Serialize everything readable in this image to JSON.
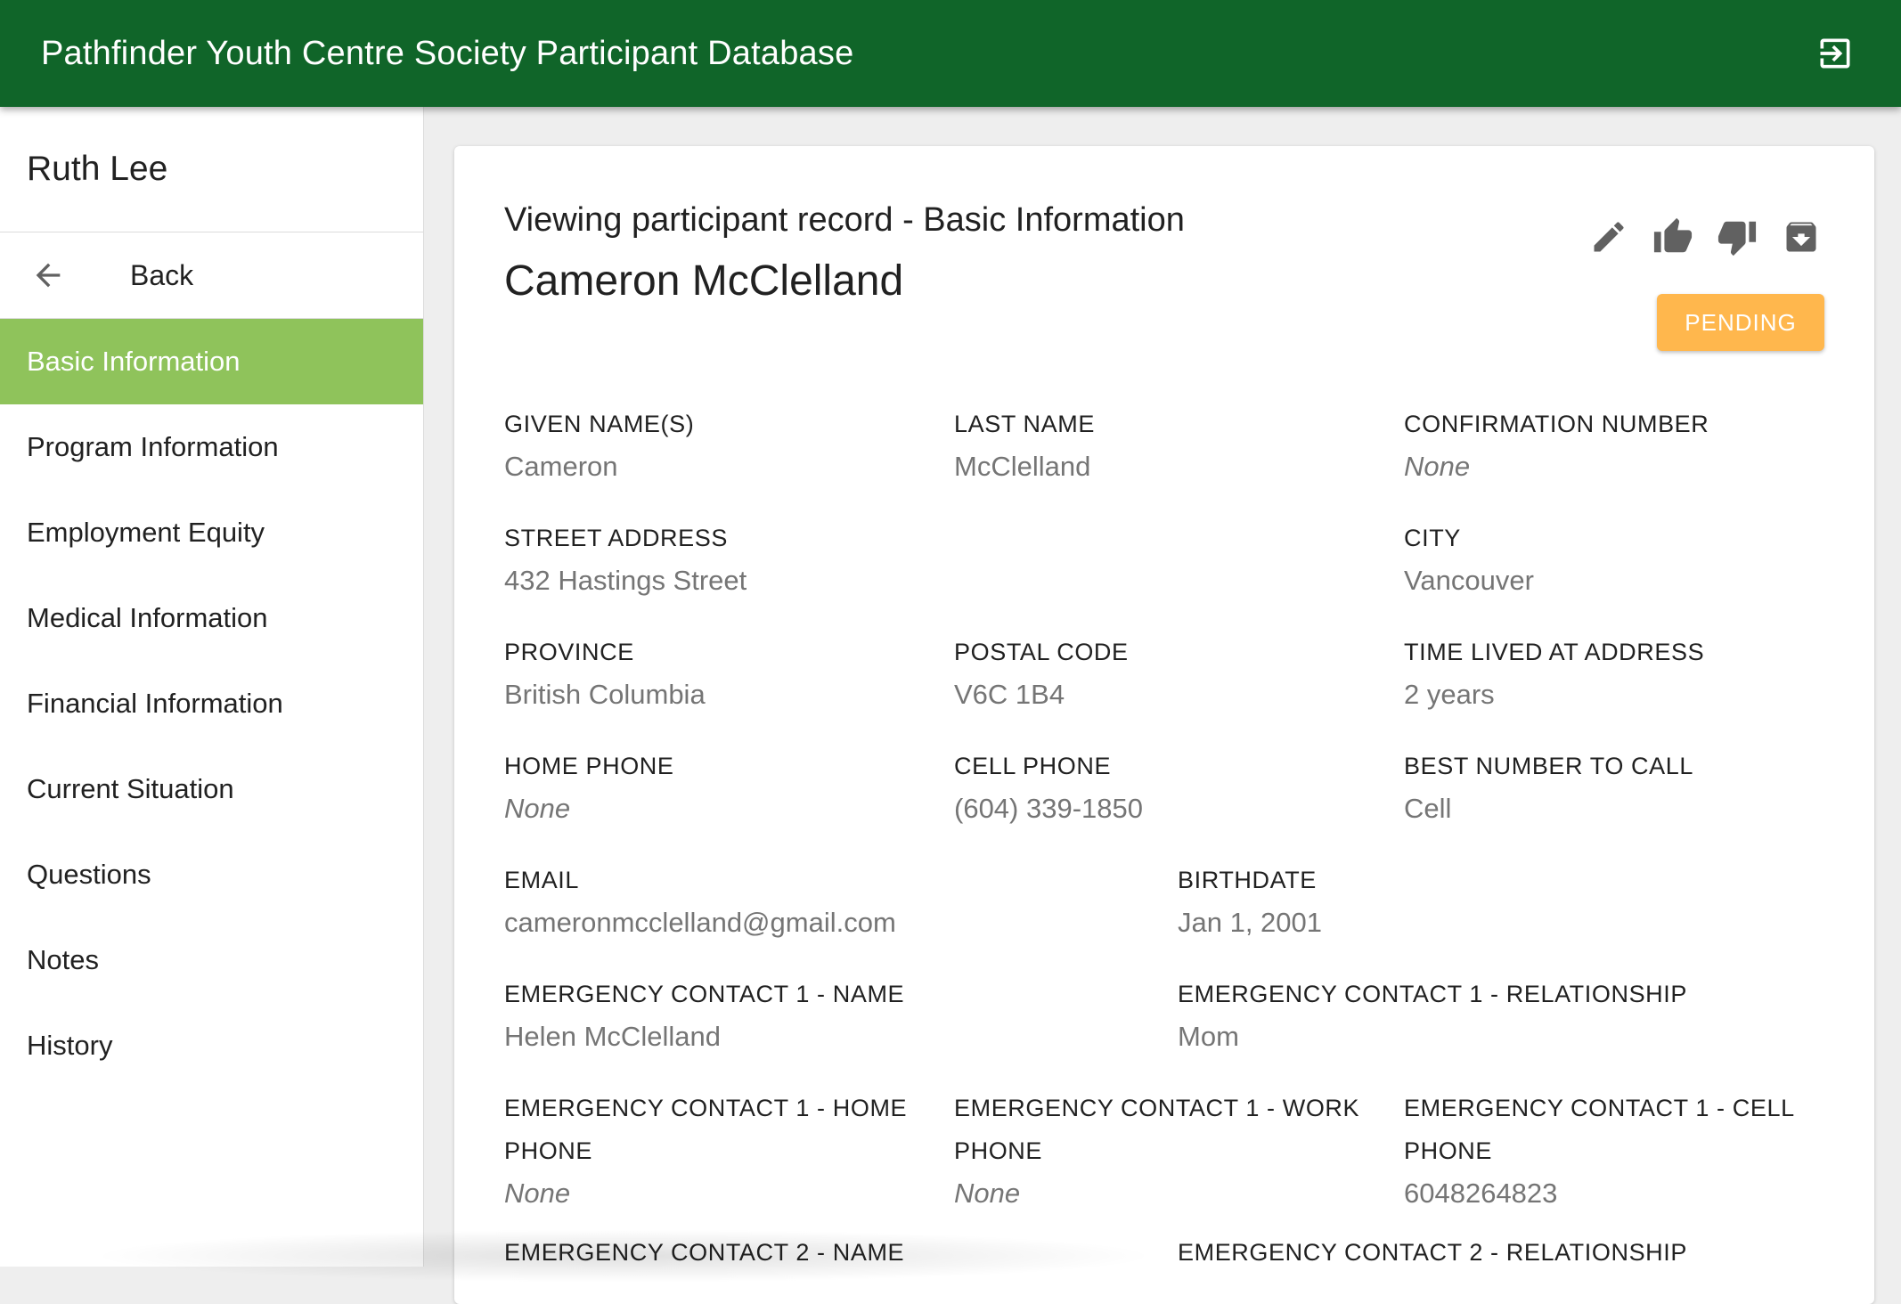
{
  "app": {
    "title": "Pathfinder Youth Centre Society Participant Database"
  },
  "drawer": {
    "user_name": "Ruth Lee",
    "back_label": "Back",
    "items": [
      {
        "label": "Basic Information",
        "active": true
      },
      {
        "label": "Program Information"
      },
      {
        "label": "Employment Equity"
      },
      {
        "label": "Medical Information"
      },
      {
        "label": "Financial Information"
      },
      {
        "label": "Current Situation"
      },
      {
        "label": "Questions"
      },
      {
        "label": "Notes"
      },
      {
        "label": "History"
      }
    ]
  },
  "record": {
    "title": "Viewing participant record - Basic Information",
    "participant_name": "Cameron McClelland",
    "status": "PENDING",
    "fields": [
      {
        "label": "Given Name(s)",
        "value": "Cameron"
      },
      {
        "label": "Last Name",
        "value": "McClelland"
      },
      {
        "label": "Confirmation Number",
        "value": "None"
      },
      {
        "label": "Street Address",
        "value": "432 Hastings Street"
      },
      {
        "label": "City",
        "value": "Vancouver"
      },
      {
        "label": "Province",
        "value": "British Columbia"
      },
      {
        "label": "Postal Code",
        "value": "V6C 1B4"
      },
      {
        "label": "Time Lived at Address",
        "value": "2 years"
      },
      {
        "label": "Home Phone",
        "value": "None"
      },
      {
        "label": "Cell Phone",
        "value": "(604) 339-1850"
      },
      {
        "label": "Best Number to Call",
        "value": "Cell"
      },
      {
        "label": "Email",
        "value": "cameronmcclelland@gmail.com"
      },
      {
        "label": "Birthdate",
        "value": "Jan 1, 2001"
      },
      {
        "label": "Emergency Contact 1 - Name",
        "value": "Helen McClelland"
      },
      {
        "label": "Emergency Contact 1 - Relationship",
        "value": "Mom"
      },
      {
        "label": "Emergency Contact 1 - Home Phone",
        "value": "None"
      },
      {
        "label": "Emergency Contact 1 - Work Phone",
        "value": "None"
      },
      {
        "label": "Emergency Contact 1 - Cell Phone",
        "value": "6048264823"
      },
      {
        "label": "Emergency Contact 2 - Name",
        "value": ""
      },
      {
        "label": "Emergency Contact 2 - Relationship",
        "value": ""
      }
    ]
  },
  "icons": {
    "logout": "exit-to-app-icon",
    "back": "arrow-left-icon",
    "edit": "pencil-icon",
    "approve": "thumb-up-icon",
    "reject": "thumb-down-icon",
    "archive": "archive-icon"
  },
  "colors": {
    "appbar": "#106529",
    "active_nav": "#8fc35b",
    "pending": "#ffb74d",
    "value_text": "#757575"
  }
}
